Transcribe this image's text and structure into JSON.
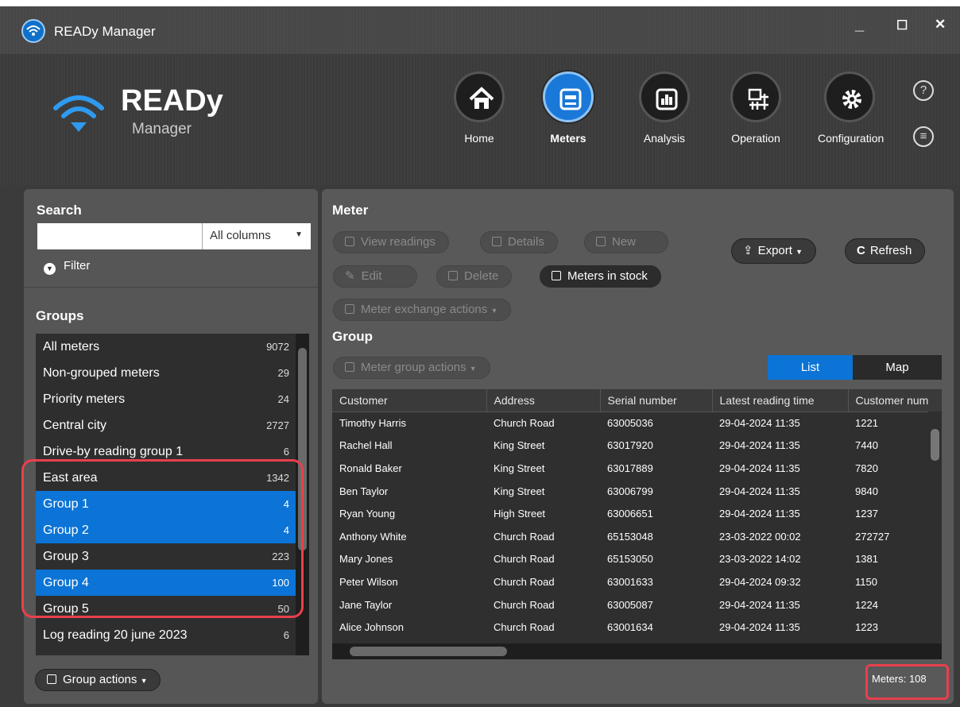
{
  "window": {
    "title": "READy Manager",
    "controls": {
      "minimize": "_",
      "maximize": "☐",
      "close": "✕"
    }
  },
  "logo": {
    "title": "READy",
    "subtitle": "Manager"
  },
  "nav": [
    {
      "label": "Home",
      "icon": "home-icon",
      "active": false
    },
    {
      "label": "Meters",
      "icon": "meter-icon",
      "active": true
    },
    {
      "label": "Analysis",
      "icon": "bar-chart-icon",
      "active": false
    },
    {
      "label": "Operation",
      "icon": "operation-icon",
      "active": false
    },
    {
      "label": "Configuration",
      "icon": "gear-icon",
      "active": false
    }
  ],
  "side_icons": {
    "help": "?",
    "info": "≡"
  },
  "search": {
    "title": "Search",
    "value": "",
    "column_select": "All columns",
    "filter_label": "Filter"
  },
  "groups": {
    "title": "Groups",
    "items": [
      {
        "label": "All meters",
        "count": "9072",
        "selected": false
      },
      {
        "label": "Non-grouped meters",
        "count": "29",
        "selected": false
      },
      {
        "label": "Priority meters",
        "count": "24",
        "selected": false
      },
      {
        "label": "Central city",
        "count": "2727",
        "selected": false
      },
      {
        "label": "Drive-by reading group 1",
        "count": "6",
        "selected": false
      },
      {
        "label": "East area",
        "count": "1342",
        "selected": false
      },
      {
        "label": "Group 1",
        "count": "4",
        "selected": true
      },
      {
        "label": "Group 2",
        "count": "4",
        "selected": true
      },
      {
        "label": "Group 3",
        "count": "223",
        "selected": false
      },
      {
        "label": "Group 4",
        "count": "100",
        "selected": true
      },
      {
        "label": "Group 5",
        "count": "50",
        "selected": false
      },
      {
        "label": "Log reading 20 june 2023",
        "count": "6",
        "selected": false
      }
    ],
    "actions_label": "Group actions"
  },
  "meter": {
    "title": "Meter",
    "buttons": {
      "view_readings": "View readings",
      "details": "Details",
      "new": "New",
      "edit": "Edit",
      "delete": "Delete",
      "meters_in_stock": "Meters in stock",
      "meter_exchange": "Meter exchange actions",
      "export": "Export",
      "refresh": "Refresh"
    }
  },
  "group_section": {
    "title": "Group",
    "actions_label": "Meter group actions",
    "view_toggle": {
      "list": "List",
      "map": "Map",
      "active": "list"
    }
  },
  "table": {
    "columns": [
      "Customer",
      "Address",
      "Serial number",
      "Latest reading time",
      "Customer num"
    ],
    "rows": [
      [
        "Timothy Harris",
        "Church Road",
        "63005036",
        "29-04-2024 11:35",
        "1221"
      ],
      [
        "Rachel Hall",
        "King Street",
        "63017920",
        "29-04-2024 11:35",
        "7440"
      ],
      [
        "Ronald Baker",
        "King Street",
        "63017889",
        "29-04-2024 11:35",
        "7820"
      ],
      [
        "Ben Taylor",
        "King Street",
        "63006799",
        "29-04-2024 11:35",
        "9840"
      ],
      [
        "Ryan Young",
        "High Street",
        "63006651",
        "29-04-2024 11:35",
        "1237"
      ],
      [
        "Anthony White",
        "Church Road",
        "65153048",
        "23-03-2022 00:02",
        "272727"
      ],
      [
        "Mary Jones",
        "Church Road",
        "65153050",
        "23-03-2022 14:02",
        "1381"
      ],
      [
        "Peter Wilson",
        "Church Road",
        "63001633",
        "29-04-2024 09:32",
        "1150"
      ],
      [
        "Jane Taylor",
        "Church Road",
        "63005087",
        "29-04-2024 11:35",
        "1224"
      ],
      [
        "Alice Johnson",
        "Church Road",
        "63001634",
        "29-04-2024 11:35",
        "1223"
      ]
    ]
  },
  "status": {
    "meters_count": "Meters: 108"
  },
  "colors": {
    "accent": "#0b74d6",
    "highlight": "#ea3f4c",
    "panel": "#565656",
    "window": "#3b3b3b"
  }
}
